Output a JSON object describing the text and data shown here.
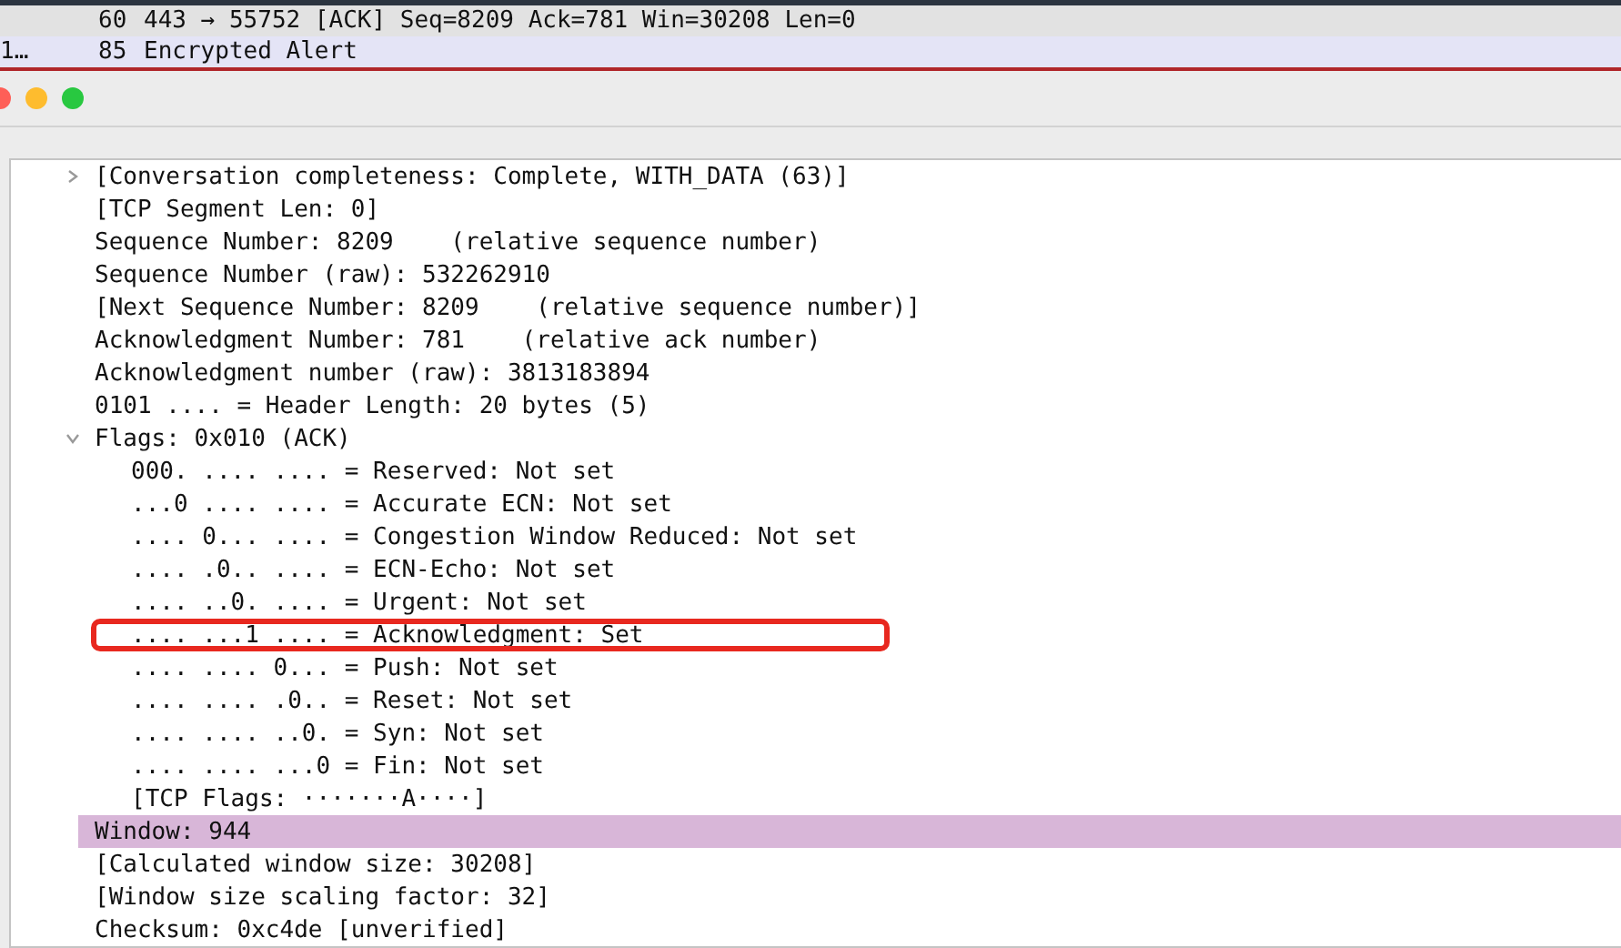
{
  "packet_list": {
    "rows": [
      {
        "column_1": "",
        "length": "60",
        "info": "443 → 55752 [ACK] Seq=8209 Ack=781 Win=30208 Len=0",
        "color": "#e2e2e2"
      },
      {
        "column_1": "1…",
        "length": "85",
        "info": "Encrypted Alert",
        "color": "#e4e4f6"
      }
    ]
  },
  "details": {
    "items": [
      {
        "text": "[Conversation completeness: Complete, WITH_DATA (63)]",
        "expandable": true,
        "expanded": false,
        "selected": false,
        "highlighted": false
      },
      {
        "text": "[TCP Segment Len: 0]",
        "selected": false,
        "highlighted": false
      },
      {
        "text": "Sequence Number: 8209    (relative sequence number)",
        "selected": false,
        "highlighted": false
      },
      {
        "text": "Sequence Number (raw): 532262910",
        "selected": false,
        "highlighted": false
      },
      {
        "text": "[Next Sequence Number: 8209    (relative sequence number)]",
        "selected": false,
        "highlighted": false
      },
      {
        "text": "Acknowledgment Number: 781    (relative ack number)",
        "selected": false,
        "highlighted": false
      },
      {
        "text": "Acknowledgment number (raw): 3813183894",
        "selected": false,
        "highlighted": false
      },
      {
        "text": "0101 .... = Header Length: 20 bytes (5)",
        "selected": false,
        "highlighted": false
      },
      {
        "text": "Flags: 0x010 (ACK)",
        "expandable": true,
        "expanded": true,
        "selected": false,
        "highlighted": false,
        "children": [
          {
            "text": "000. .... .... = Reserved: Not set",
            "selected": false,
            "highlighted": false
          },
          {
            "text": "...0 .... .... = Accurate ECN: Not set",
            "selected": false,
            "highlighted": false
          },
          {
            "text": ".... 0... .... = Congestion Window Reduced: Not set",
            "selected": false,
            "highlighted": false
          },
          {
            "text": ".... .0.. .... = ECN-Echo: Not set",
            "selected": false,
            "highlighted": false
          },
          {
            "text": ".... ..0. .... = Urgent: Not set",
            "selected": false,
            "highlighted": false
          },
          {
            "text": ".... ...1 .... = Acknowledgment: Set",
            "selected": false,
            "highlighted": true
          },
          {
            "text": ".... .... 0... = Push: Not set",
            "selected": false,
            "highlighted": false
          },
          {
            "text": ".... .... .0.. = Reset: Not set",
            "selected": false,
            "highlighted": false
          },
          {
            "text": ".... .... ..0. = Syn: Not set",
            "selected": false,
            "highlighted": false
          },
          {
            "text": ".... .... ...0 = Fin: Not set",
            "selected": false,
            "highlighted": false
          },
          {
            "text": "[TCP Flags: ·······A····]",
            "selected": false,
            "highlighted": false
          }
        ]
      },
      {
        "text": "Window: 944",
        "selected": true,
        "highlighted": false
      },
      {
        "text": "[Calculated window size: 30208]",
        "selected": false,
        "highlighted": false
      },
      {
        "text": "[Window size scaling factor: 32]",
        "selected": false,
        "highlighted": false
      },
      {
        "text": "Checksum: 0xc4de [unverified]",
        "selected": false,
        "highlighted": false
      }
    ]
  }
}
